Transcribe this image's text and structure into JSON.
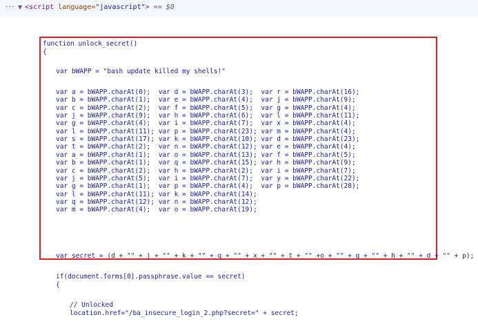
{
  "devtools": {
    "menu_dots": "···",
    "expand_triangle": "▼",
    "tag_open": "<script",
    "tag_attr": " language=",
    "tag_attr_value": "\"javascript\"",
    "tag_close": ">",
    "eq_text": " == ",
    "ref_text": "$0"
  },
  "code": {
    "func_decl": "function unlock_secret()",
    "open_brace": "{",
    "bwapp_decl": "var bWAPP = \"bash update killed my shells!\"",
    "var_rows": [
      "var a = bWAPP.charAt(0);  var d = bWAPP.charAt(3);  var r = bWAPP.charAt(16);",
      "var b = bWAPP.charAt(1);  var e = bWAPP.charAt(4);  var j = bWAPP.charAt(9);",
      "var c = bWAPP.charAt(2);  var f = bWAPP.charAt(5);  var g = bWAPP.charAt(4);",
      "var j = bWAPP.charAt(9);  var h = bWAPP.charAt(6);  var l = bWAPP.charAt(11);",
      "var g = bWAPP.charAt(4);  var i = bWAPP.charAt(7);  var x = bWAPP.charAt(4);",
      "var l = bWAPP.charAt(11); var p = bWAPP.charAt(23); var m = bWAPP.charAt(4);",
      "var s = bWAPP.charAt(17); var k = bWAPP.charAt(10); var d = bWAPP.charAt(23);",
      "var t = bWAPP.charAt(2);  var n = bWAPP.charAt(12); var e = bWAPP.charAt(4);",
      "var a = bWAPP.charAt(1);  var o = bWAPP.charAt(13); var f = bWAPP.charAt(5);",
      "var b = bWAPP.charAt(1);  var q = bWAPP.charAt(15); var h = bWAPP.charAt(9);",
      "var c = bWAPP.charAt(2);  var h = bWAPP.charAt(2);  var i = bWAPP.charAt(7);",
      "var j = bWAPP.charAt(5);  var i = bWAPP.charAt(7);  var y = bWAPP.charAt(22);",
      "var g = bWAPP.charAt(1);  var p = bWAPP.charAt(4);  var p = bWAPP.charAt(28);",
      "var l = bWAPP.charAt(11); var k = bWAPP.charAt(14);",
      "var q = bWAPP.charAt(12); var n = bWAPP.charAt(12);",
      "var m = bWAPP.charAt(4);  var o = bWAPP.charAt(19);"
    ],
    "secret_line": "var secret = (d + \"\" + j + \"\" + k + \"\" + q + \"\" + x + \"\" + t + \"\" +o + \"\" + g + \"\" + h + \"\" + d + \"\" + p);",
    "if_line": "if(document.forms[0].passphrase.value == secret)",
    "if_brace": "{",
    "comment_line": "// Unlocked",
    "location_line": "location.href=\"/ba_insecure_login_2.php?secret=\" + secret;"
  }
}
